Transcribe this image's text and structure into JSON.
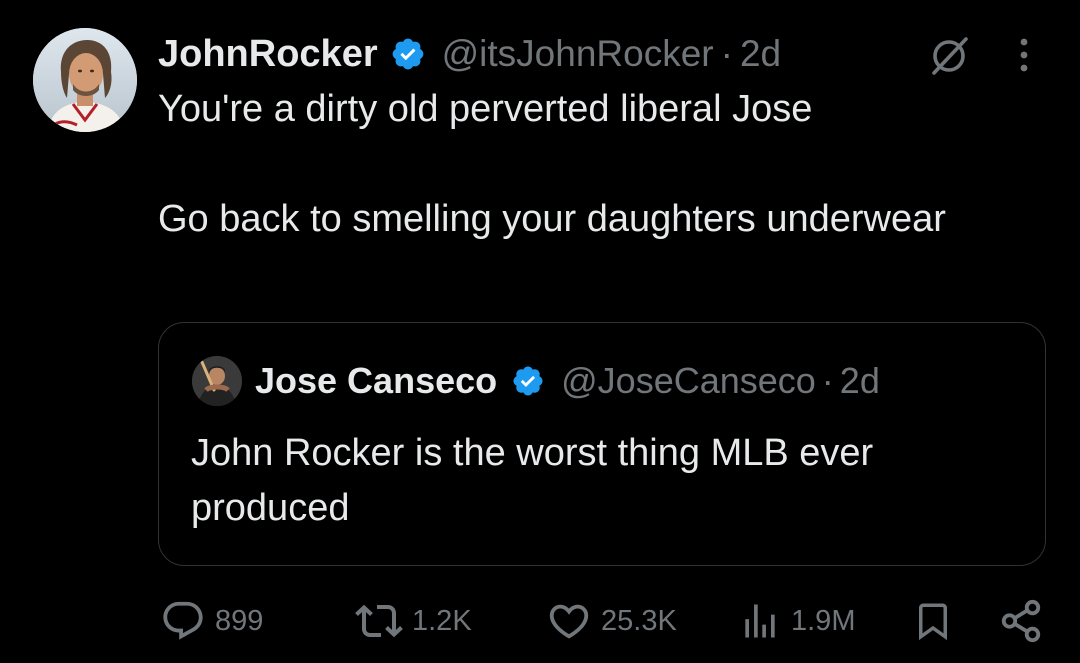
{
  "tweet": {
    "author": {
      "display_name": "JohnRocker",
      "handle": "@itsJohnRocker",
      "verified": true
    },
    "separator": "·",
    "time": "2d",
    "text_lines": [
      "You're a dirty old perverted liberal Jose",
      "Go back to smelling your daughters underwear"
    ],
    "quote": {
      "author": {
        "display_name": "Jose Canseco",
        "handle": "@JoseCanseco",
        "verified": true
      },
      "separator": "·",
      "time": "2d",
      "text": "John Rocker is the worst thing MLB ever produced"
    },
    "actions": {
      "replies": "899",
      "reposts": "1.2K",
      "likes": "25.3K",
      "views": "1.9M"
    }
  },
  "colors": {
    "background": "#000000",
    "primary_text": "#e7e9ea",
    "secondary_text": "#71767b",
    "verified_blue": "#1d9bf0",
    "border": "#2f3336"
  },
  "icons": {
    "verified": "verified-badge-icon",
    "grok": "grok-icon",
    "more": "more-dots-icon",
    "reply": "reply-icon",
    "repost": "repost-icon",
    "like": "heart-icon",
    "views": "views-bar-icon",
    "bookmark": "bookmark-icon",
    "share": "share-icon"
  }
}
